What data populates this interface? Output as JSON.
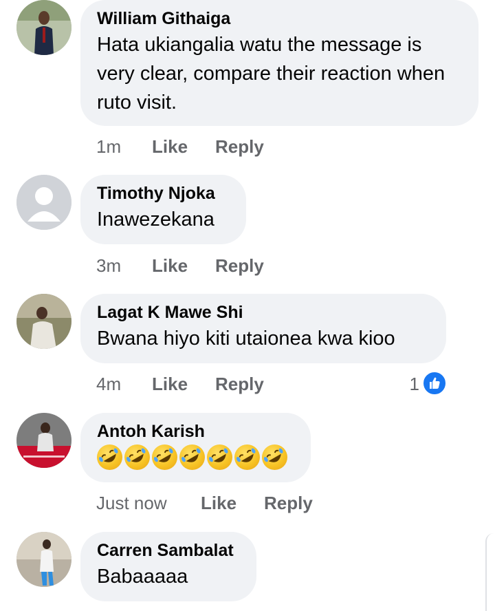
{
  "comments": [
    {
      "author": "William Githaiga",
      "text": "Hata ukiangalia watu the message is very clear, compare their reaction when ruto visit.",
      "time": "1m",
      "like_label": "Like",
      "reply_label": "Reply"
    },
    {
      "author": "Timothy Njoka",
      "text": "Inawezekana",
      "time": "3m",
      "like_label": "Like",
      "reply_label": "Reply"
    },
    {
      "author": "Lagat K Mawe Shi",
      "text": "Bwana hiyo kiti utaionea kwa kioo",
      "time": "4m",
      "like_label": "Like",
      "reply_label": "Reply",
      "reaction_count": "1"
    },
    {
      "author": "Antoh Karish",
      "emojis": [
        "rofl",
        "rofl",
        "rofl",
        "rofl",
        "rofl",
        "rofl",
        "rofl"
      ],
      "time": "Just now",
      "like_label": "Like",
      "reply_label": "Reply"
    },
    {
      "author": "Carren Sambalat",
      "text": "Babaaaaa"
    }
  ],
  "colors": {
    "bubble": "#f0f2f5",
    "meta_text": "#65676b",
    "like_blue": "#1877f2"
  },
  "icons": {
    "reaction": "like-thumbs-up-icon",
    "emoji": "rolling-on-floor-laughing-emoji",
    "default_avatar": "default-avatar-silhouette"
  }
}
